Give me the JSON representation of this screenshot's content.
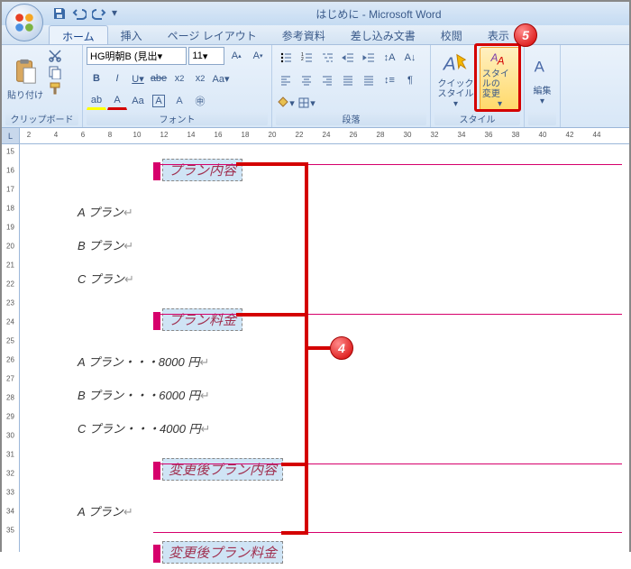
{
  "title": "はじめに - Microsoft Word",
  "tabs": [
    "ホーム",
    "挿入",
    "ページ レイアウト",
    "参考資料",
    "差し込み文書",
    "校閲",
    "表示"
  ],
  "groups": {
    "clipboard": {
      "label": "クリップボード",
      "paste": "貼り付け"
    },
    "font": {
      "label": "フォント",
      "name": "HG明朝B (見出",
      "size": "11"
    },
    "paragraph": {
      "label": "段落"
    },
    "styles": {
      "label": "スタイル",
      "quick": "クイック\nスタイル",
      "change": "スタイルの\n変更"
    },
    "editing": {
      "label": "編集"
    }
  },
  "doc": {
    "h1": "プラン内容",
    "l1": "A プラン",
    "l2": "B プラン",
    "l3": "C プラン",
    "h2": "プラン料金",
    "l4": "A プラン・・・8000 円",
    "l5": "B プラン・・・6000 円",
    "l6": "C プラン・・・4000 円",
    "h3": "変更後プラン内容",
    "l7": "A プラン",
    "h4": "変更後プラン料金"
  },
  "ruler_h": [
    2,
    4,
    6,
    8,
    10,
    12,
    14,
    16,
    18,
    20,
    22,
    24,
    26,
    28,
    30,
    32,
    34,
    36,
    38,
    40,
    42,
    44
  ],
  "ruler_v": [
    15,
    16,
    17,
    18,
    19,
    20,
    21,
    22,
    23,
    24,
    25,
    26,
    27,
    28,
    29,
    30,
    31,
    32,
    33,
    34,
    35
  ],
  "callouts": {
    "four": "4",
    "five": "5"
  }
}
